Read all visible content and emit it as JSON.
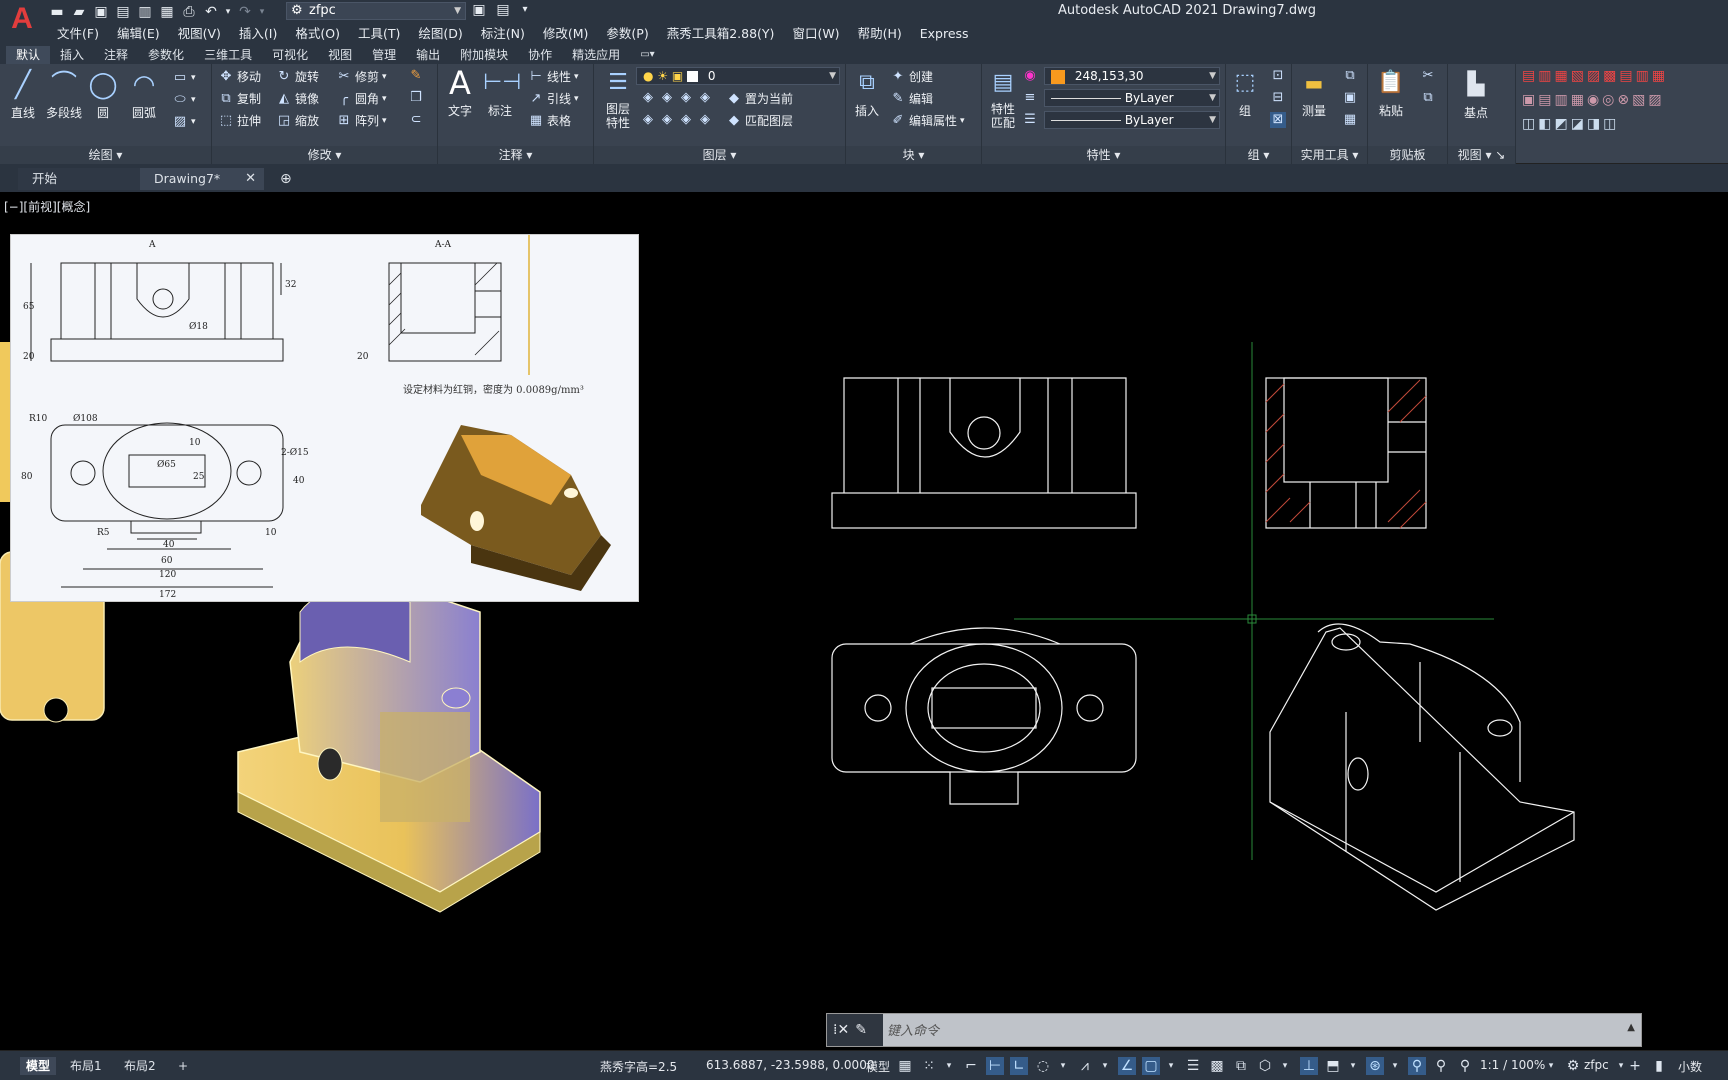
{
  "title_bar": {
    "app_title": "Autodesk AutoCAD 2021    Drawing7.dwg",
    "workspace": "zfpc"
  },
  "menu": [
    "文件(F)",
    "编辑(E)",
    "视图(V)",
    "插入(I)",
    "格式(O)",
    "工具(T)",
    "绘图(D)",
    "标注(N)",
    "修改(M)",
    "参数(P)",
    "燕秀工具箱2.88(Y)",
    "窗口(W)",
    "帮助(H)",
    "Express"
  ],
  "ribbon_tabs": [
    "默认",
    "插入",
    "注释",
    "参数化",
    "三维工具",
    "可视化",
    "视图",
    "管理",
    "输出",
    "附加模块",
    "协作",
    "精选应用"
  ],
  "ribbon": {
    "draw": {
      "title": "绘图",
      "line": "直线",
      "polyline": "多段线",
      "circle": "圆",
      "arc": "圆弧"
    },
    "modify": {
      "title": "修改",
      "move": "移动",
      "rotate": "旋转",
      "trim": "修剪",
      "copy": "复制",
      "mirror": "镜像",
      "fillet": "圆角",
      "stretch": "拉伸",
      "scale": "缩放",
      "array": "阵列"
    },
    "annotation": {
      "title": "注释",
      "text": "文字",
      "dimension": "标注",
      "linear": "线性",
      "leader": "引线",
      "table": "表格"
    },
    "layers": {
      "title": "图层",
      "layer_props": "图层特性",
      "current_layer": "0",
      "set_current": "置为当前",
      "match_layer": "匹配图层"
    },
    "block": {
      "title": "块",
      "insert": "插入",
      "create": "创建",
      "edit": "编辑",
      "edit_attr": "编辑属性"
    },
    "properties": {
      "title": "特性",
      "match": "特性匹配",
      "color": "248,153,30",
      "color_hex": "#f8991e",
      "linetype": "ByLayer",
      "lineweight": "ByLayer"
    },
    "groups": {
      "title": "组",
      "group": "组"
    },
    "utilities": {
      "title": "实用工具",
      "measure": "测量"
    },
    "clipboard": {
      "title": "剪贴板",
      "paste": "粘贴"
    },
    "view": {
      "title": "视图",
      "base": "基点"
    }
  },
  "file_tabs": {
    "start": "开始",
    "drawing": "Drawing7*"
  },
  "viewport": {
    "label": "[−][前视][概念]",
    "reference_note": "设定材料为红铜，密度为 0.0089g/mm³",
    "ref_labels": {
      "section_mark": "A",
      "section_title": "A-A",
      "dims": [
        "65",
        "32",
        "20",
        "Ø18",
        "20",
        "R10",
        "Ø108",
        "2-Ø15",
        "80",
        "40",
        "10",
        "25",
        "R5",
        "40",
        "60",
        "120",
        "172",
        "10",
        "Ø65"
      ]
    }
  },
  "command_line": {
    "placeholder": "键入命令"
  },
  "status_bar": {
    "layout_tabs": [
      "模型",
      "布局1",
      "布局2"
    ],
    "text_height": "燕秀字高=2.5",
    "coords": "613.6887, -23.5988, 0.0000",
    "model": "模型",
    "scale": "1:1 / 100%",
    "workspace": "zfpc",
    "units": "小数"
  }
}
